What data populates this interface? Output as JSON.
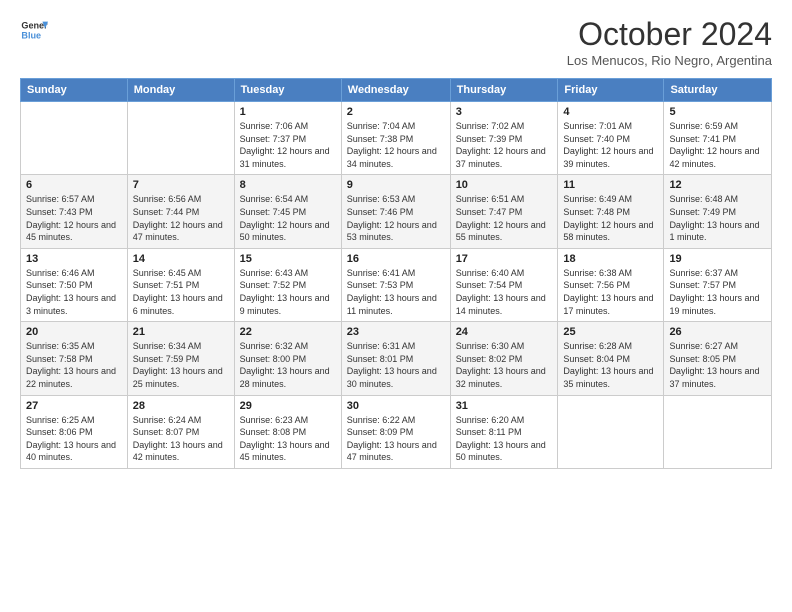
{
  "logo": {
    "line1": "General",
    "line2": "Blue"
  },
  "title": "October 2024",
  "subtitle": "Los Menucos, Rio Negro, Argentina",
  "weekdays": [
    "Sunday",
    "Monday",
    "Tuesday",
    "Wednesday",
    "Thursday",
    "Friday",
    "Saturday"
  ],
  "weeks": [
    [
      {
        "day": "",
        "info": ""
      },
      {
        "day": "",
        "info": ""
      },
      {
        "day": "1",
        "info": "Sunrise: 7:06 AM\nSunset: 7:37 PM\nDaylight: 12 hours and 31 minutes."
      },
      {
        "day": "2",
        "info": "Sunrise: 7:04 AM\nSunset: 7:38 PM\nDaylight: 12 hours and 34 minutes."
      },
      {
        "day": "3",
        "info": "Sunrise: 7:02 AM\nSunset: 7:39 PM\nDaylight: 12 hours and 37 minutes."
      },
      {
        "day": "4",
        "info": "Sunrise: 7:01 AM\nSunset: 7:40 PM\nDaylight: 12 hours and 39 minutes."
      },
      {
        "day": "5",
        "info": "Sunrise: 6:59 AM\nSunset: 7:41 PM\nDaylight: 12 hours and 42 minutes."
      }
    ],
    [
      {
        "day": "6",
        "info": "Sunrise: 6:57 AM\nSunset: 7:43 PM\nDaylight: 12 hours and 45 minutes."
      },
      {
        "day": "7",
        "info": "Sunrise: 6:56 AM\nSunset: 7:44 PM\nDaylight: 12 hours and 47 minutes."
      },
      {
        "day": "8",
        "info": "Sunrise: 6:54 AM\nSunset: 7:45 PM\nDaylight: 12 hours and 50 minutes."
      },
      {
        "day": "9",
        "info": "Sunrise: 6:53 AM\nSunset: 7:46 PM\nDaylight: 12 hours and 53 minutes."
      },
      {
        "day": "10",
        "info": "Sunrise: 6:51 AM\nSunset: 7:47 PM\nDaylight: 12 hours and 55 minutes."
      },
      {
        "day": "11",
        "info": "Sunrise: 6:49 AM\nSunset: 7:48 PM\nDaylight: 12 hours and 58 minutes."
      },
      {
        "day": "12",
        "info": "Sunrise: 6:48 AM\nSunset: 7:49 PM\nDaylight: 13 hours and 1 minute."
      }
    ],
    [
      {
        "day": "13",
        "info": "Sunrise: 6:46 AM\nSunset: 7:50 PM\nDaylight: 13 hours and 3 minutes."
      },
      {
        "day": "14",
        "info": "Sunrise: 6:45 AM\nSunset: 7:51 PM\nDaylight: 13 hours and 6 minutes."
      },
      {
        "day": "15",
        "info": "Sunrise: 6:43 AM\nSunset: 7:52 PM\nDaylight: 13 hours and 9 minutes."
      },
      {
        "day": "16",
        "info": "Sunrise: 6:41 AM\nSunset: 7:53 PM\nDaylight: 13 hours and 11 minutes."
      },
      {
        "day": "17",
        "info": "Sunrise: 6:40 AM\nSunset: 7:54 PM\nDaylight: 13 hours and 14 minutes."
      },
      {
        "day": "18",
        "info": "Sunrise: 6:38 AM\nSunset: 7:56 PM\nDaylight: 13 hours and 17 minutes."
      },
      {
        "day": "19",
        "info": "Sunrise: 6:37 AM\nSunset: 7:57 PM\nDaylight: 13 hours and 19 minutes."
      }
    ],
    [
      {
        "day": "20",
        "info": "Sunrise: 6:35 AM\nSunset: 7:58 PM\nDaylight: 13 hours and 22 minutes."
      },
      {
        "day": "21",
        "info": "Sunrise: 6:34 AM\nSunset: 7:59 PM\nDaylight: 13 hours and 25 minutes."
      },
      {
        "day": "22",
        "info": "Sunrise: 6:32 AM\nSunset: 8:00 PM\nDaylight: 13 hours and 28 minutes."
      },
      {
        "day": "23",
        "info": "Sunrise: 6:31 AM\nSunset: 8:01 PM\nDaylight: 13 hours and 30 minutes."
      },
      {
        "day": "24",
        "info": "Sunrise: 6:30 AM\nSunset: 8:02 PM\nDaylight: 13 hours and 32 minutes."
      },
      {
        "day": "25",
        "info": "Sunrise: 6:28 AM\nSunset: 8:04 PM\nDaylight: 13 hours and 35 minutes."
      },
      {
        "day": "26",
        "info": "Sunrise: 6:27 AM\nSunset: 8:05 PM\nDaylight: 13 hours and 37 minutes."
      }
    ],
    [
      {
        "day": "27",
        "info": "Sunrise: 6:25 AM\nSunset: 8:06 PM\nDaylight: 13 hours and 40 minutes."
      },
      {
        "day": "28",
        "info": "Sunrise: 6:24 AM\nSunset: 8:07 PM\nDaylight: 13 hours and 42 minutes."
      },
      {
        "day": "29",
        "info": "Sunrise: 6:23 AM\nSunset: 8:08 PM\nDaylight: 13 hours and 45 minutes."
      },
      {
        "day": "30",
        "info": "Sunrise: 6:22 AM\nSunset: 8:09 PM\nDaylight: 13 hours and 47 minutes."
      },
      {
        "day": "31",
        "info": "Sunrise: 6:20 AM\nSunset: 8:11 PM\nDaylight: 13 hours and 50 minutes."
      },
      {
        "day": "",
        "info": ""
      },
      {
        "day": "",
        "info": ""
      }
    ]
  ]
}
